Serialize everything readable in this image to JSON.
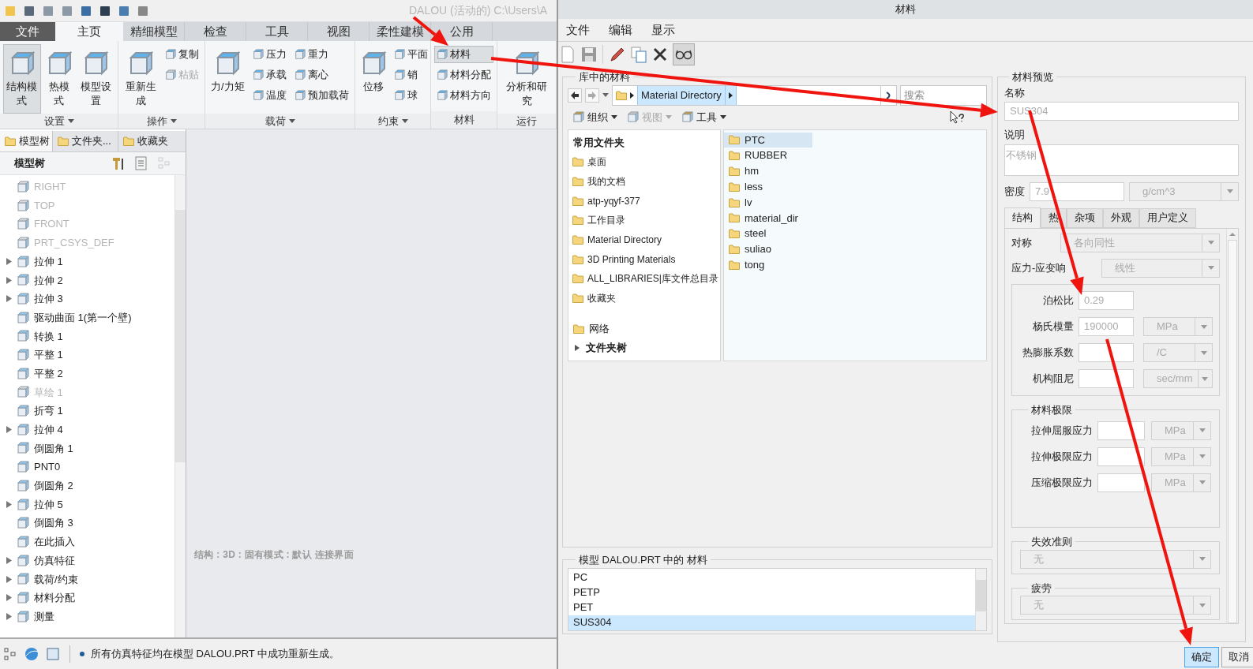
{
  "app": {
    "title": "DALOU (活动的) C:\\Users\\A"
  },
  "ribbon_tabs": [
    {
      "label": "文件",
      "kind": "file",
      "selected": false
    },
    {
      "label": "主页",
      "kind": "tab",
      "selected": true
    },
    {
      "label": "精细模型",
      "kind": "tab",
      "selected": false
    },
    {
      "label": "检查",
      "kind": "tab",
      "selected": false
    },
    {
      "label": "工具",
      "kind": "tab",
      "selected": false
    },
    {
      "label": "视图",
      "kind": "tab",
      "selected": false
    },
    {
      "label": "柔性建模",
      "kind": "tab",
      "selected": false
    },
    {
      "label": "公用",
      "kind": "tab",
      "selected": false
    }
  ],
  "ribbon_groups": [
    {
      "label": "设置",
      "menu": true,
      "items": [
        {
          "label": "结构模式",
          "kind": "large",
          "selected": true,
          "disabled": false
        },
        {
          "label": "热模式",
          "kind": "large",
          "selected": false,
          "disabled": false
        },
        {
          "label": "模型设置",
          "kind": "large",
          "selected": false,
          "disabled": false
        }
      ]
    },
    {
      "label": "操作",
      "menu": true,
      "items": [
        {
          "label": "重新生成",
          "kind": "large",
          "selected": false,
          "disabled": false
        },
        {
          "label": "复制",
          "kind": "small",
          "selected": false,
          "disabled": false
        },
        {
          "label": "粘贴",
          "kind": "small",
          "selected": false,
          "disabled": true
        }
      ]
    },
    {
      "label": "载荷",
      "menu": true,
      "items": [
        {
          "label": "力/力矩",
          "kind": "large",
          "selected": false,
          "disabled": false
        },
        {
          "label": "压力",
          "kind": "small",
          "selected": false,
          "disabled": false
        },
        {
          "label": "承载",
          "kind": "small",
          "selected": false,
          "disabled": false
        },
        {
          "label": "温度",
          "kind": "small",
          "selected": false,
          "disabled": false
        },
        {
          "label": "重力",
          "kind": "small",
          "selected": false,
          "disabled": false
        },
        {
          "label": "离心",
          "kind": "small",
          "selected": false,
          "disabled": false
        },
        {
          "label": "预加载荷",
          "kind": "small",
          "selected": false,
          "disabled": false
        }
      ]
    },
    {
      "label": "约束",
      "menu": true,
      "items": [
        {
          "label": "位移",
          "kind": "large",
          "selected": false,
          "disabled": false
        },
        {
          "label": "平面",
          "kind": "small",
          "selected": false,
          "disabled": false
        },
        {
          "label": "销",
          "kind": "small",
          "selected": false,
          "disabled": false
        },
        {
          "label": "球",
          "kind": "small",
          "selected": false,
          "disabled": false
        }
      ]
    },
    {
      "label": "材料",
      "menu": false,
      "items": [
        {
          "label": "材料",
          "kind": "small",
          "selected": true,
          "disabled": false
        },
        {
          "label": "材料分配",
          "kind": "small",
          "selected": false,
          "disabled": false
        },
        {
          "label": "材料方向",
          "kind": "small",
          "selected": false,
          "disabled": false
        }
      ]
    },
    {
      "label": "运行",
      "menu": false,
      "items": [
        {
          "label": "分析和研究",
          "kind": "large",
          "selected": false,
          "disabled": false
        }
      ]
    }
  ],
  "tree_tabs": [
    {
      "label": "模型树",
      "selected": true
    },
    {
      "label": "文件夹...",
      "selected": false
    },
    {
      "label": "收藏夹",
      "selected": false
    }
  ],
  "tree_header": "模型树",
  "tree_items": [
    {
      "label": "RIGHT",
      "expandable": false,
      "dimmed": true
    },
    {
      "label": "TOP",
      "expandable": false,
      "dimmed": true
    },
    {
      "label": "FRONT",
      "expandable": false,
      "dimmed": true
    },
    {
      "label": "PRT_CSYS_DEF",
      "expandable": false,
      "dimmed": true
    },
    {
      "label": "拉伸 1",
      "expandable": true,
      "dimmed": false
    },
    {
      "label": "拉伸 2",
      "expandable": true,
      "dimmed": false
    },
    {
      "label": "拉伸 3",
      "expandable": true,
      "dimmed": false
    },
    {
      "label": "驱动曲面 1(第一个壁)",
      "expandable": false,
      "dimmed": false
    },
    {
      "label": "转换 1",
      "expandable": false,
      "dimmed": false
    },
    {
      "label": "平整 1",
      "expandable": false,
      "dimmed": false
    },
    {
      "label": "平整 2",
      "expandable": false,
      "dimmed": false
    },
    {
      "label": "草绘 1",
      "expandable": false,
      "dimmed": true
    },
    {
      "label": "折弯 1",
      "expandable": false,
      "dimmed": false
    },
    {
      "label": "拉伸 4",
      "expandable": true,
      "dimmed": false
    },
    {
      "label": "倒圆角 1",
      "expandable": false,
      "dimmed": false
    },
    {
      "label": "PNT0",
      "expandable": false,
      "dimmed": false
    },
    {
      "label": "倒圆角 2",
      "expandable": false,
      "dimmed": false
    },
    {
      "label": "拉伸 5",
      "expandable": true,
      "dimmed": false
    },
    {
      "label": "倒圆角 3",
      "expandable": false,
      "dimmed": false
    },
    {
      "label": "在此插入",
      "expandable": false,
      "dimmed": false
    },
    {
      "label": "仿真特征",
      "expandable": true,
      "dimmed": false
    },
    {
      "label": "载荷/约束",
      "expandable": true,
      "dimmed": false
    },
    {
      "label": "材料分配",
      "expandable": true,
      "dimmed": false
    },
    {
      "label": "测量",
      "expandable": true,
      "dimmed": false
    }
  ],
  "graphics_caption": "结构 : 3D : 固有模式 : 默认 连接界面",
  "status_bar": "所有仿真特征均在模型 DALOU.PRT 中成功重新生成。",
  "dialog": {
    "title": "材料",
    "menu": [
      "文件",
      "编辑",
      "显示"
    ],
    "preview_toggle_pressed": true,
    "library": {
      "title": "库中的材料",
      "path": "Material Directory",
      "search_placeholder": "搜索",
      "commands": [
        {
          "label": "组织",
          "disabled": false
        },
        {
          "label": "视图",
          "disabled": true
        },
        {
          "label": "工具",
          "disabled": false
        }
      ],
      "places_header": "常用文件夹",
      "places": [
        "桌面",
        "我的文档",
        "atp-yqyf-377",
        "工作目录",
        "Material Directory",
        "3D Printing Materials",
        "ALL_LIBRARIES|库文件总目录",
        "收藏夹"
      ],
      "network": "网络",
      "folder_tree": "文件夹树",
      "folders": [
        {
          "label": "PTC",
          "selected": true
        },
        {
          "label": "RUBBER",
          "selected": false
        },
        {
          "label": "hm",
          "selected": false
        },
        {
          "label": "less",
          "selected": false
        },
        {
          "label": "lv",
          "selected": false
        },
        {
          "label": "material_dir",
          "selected": false
        },
        {
          "label": "steel",
          "selected": false
        },
        {
          "label": "suliao",
          "selected": false
        },
        {
          "label": "tong",
          "selected": false
        }
      ]
    },
    "model_materials": {
      "title": "模型 DALOU.PRT 中的 材料",
      "items": [
        {
          "label": "PC",
          "selected": false
        },
        {
          "label": "PETP",
          "selected": false
        },
        {
          "label": "PET",
          "selected": false
        },
        {
          "label": "SUS304",
          "selected": true
        }
      ]
    },
    "preview": {
      "title": "材料预览",
      "name_label": "名称",
      "name": "SUS304",
      "description_label": "说明",
      "description": "不锈钢",
      "density_label": "密度",
      "density": "7.9",
      "density_unit": "g/cm^3",
      "tabs": [
        {
          "label": "结构",
          "selected": true
        },
        {
          "label": "热",
          "selected": false
        },
        {
          "label": "杂项",
          "selected": false
        },
        {
          "label": "外观",
          "selected": false
        },
        {
          "label": "用户定义",
          "selected": false
        }
      ],
      "symmetry": {
        "label": "对称",
        "value": "各向同性"
      },
      "stress_strain": {
        "label": "应力-应变响",
        "value": "线性"
      },
      "properties": [
        {
          "label": "泊松比",
          "value": "0.29"
        },
        {
          "label": "杨氏模量",
          "value": "190000",
          "unit": "MPa"
        },
        {
          "label": "热膨胀系数",
          "unit": "/C"
        },
        {
          "label": "机构阻尼",
          "unit": "sec/mm"
        }
      ],
      "limits": {
        "title": "材料极限",
        "rows": [
          {
            "label": "拉伸屈服应力",
            "unit": "MPa"
          },
          {
            "label": "拉伸极限应力",
            "unit": "MPa"
          },
          {
            "label": "压缩极限应力",
            "unit": "MPa"
          }
        ]
      },
      "failure": {
        "title": "失效准则",
        "value": "无"
      },
      "fatigue": {
        "title": "疲劳",
        "value": "无"
      }
    },
    "buttons": [
      {
        "label": "确定",
        "selected": true
      },
      {
        "label": "取消",
        "selected": false
      }
    ]
  }
}
